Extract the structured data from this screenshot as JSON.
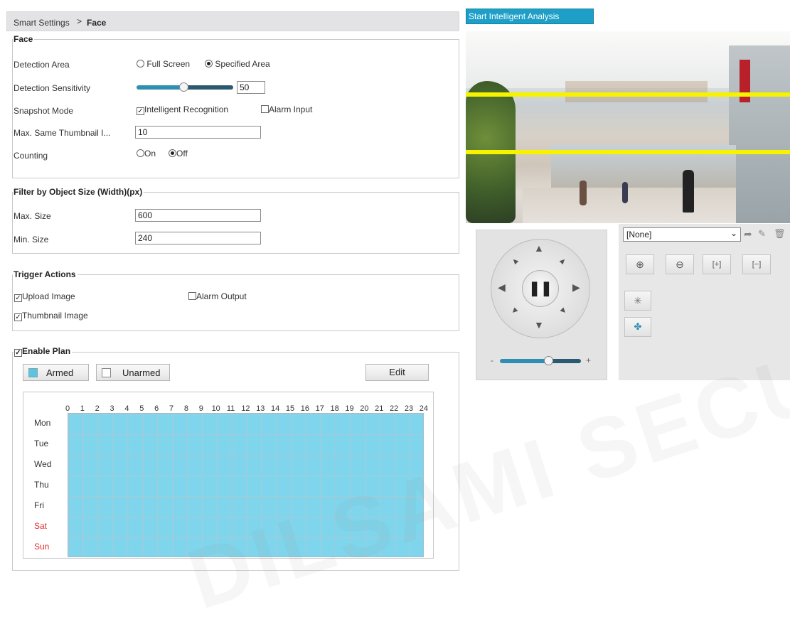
{
  "breadcrumb": {
    "parent": "Smart Settings",
    "separator": ">",
    "current": "Face"
  },
  "face": {
    "legend": "Face",
    "detection_area": {
      "label": "Detection Area",
      "options": [
        "Full Screen",
        "Specified Area"
      ],
      "selected": "Specified Area"
    },
    "detection_sensitivity": {
      "label": "Detection Sensitivity",
      "value": "50",
      "slider_level_percent": 50
    },
    "snapshot_mode": {
      "label": "Snapshot Mode",
      "opt1": "Intelligent Recognition",
      "opt1_checked": true,
      "opt2": "Alarm Input",
      "opt2_checked": false
    },
    "max_thumbnail": {
      "label": "Max. Same Thumbnail I...",
      "value": "10"
    },
    "counting": {
      "label": "Counting",
      "on": "On",
      "off": "Off",
      "selected": "Off"
    }
  },
  "filter": {
    "legend": "Filter by Object Size (Width)(px)",
    "max_label": "Max. Size",
    "max_value": "600",
    "min_label": "Min. Size",
    "min_value": "240"
  },
  "trigger": {
    "legend": "Trigger Actions",
    "upload_image": "Upload Image",
    "alarm_output": "Alarm Output",
    "thumbnail_image": "Thumbnail Image"
  },
  "plan": {
    "legend": "Enable Plan",
    "armed": "Armed",
    "unarmed": "Unarmed",
    "edit": "Edit",
    "hours": [
      "0",
      "1",
      "2",
      "3",
      "4",
      "5",
      "6",
      "7",
      "8",
      "9",
      "10",
      "11",
      "12",
      "13",
      "14",
      "15",
      "16",
      "17",
      "18",
      "19",
      "20",
      "21",
      "22",
      "23",
      "24"
    ],
    "days": [
      "Mon",
      "Tue",
      "Wed",
      "Thu",
      "Fri",
      "Sat",
      "Sun"
    ],
    "weekend_color": "#e03030",
    "armed_color": "#7fd6ec"
  },
  "analysis_button": "Start Intelligent Analysis",
  "ptz": {
    "preset_value": "[None]",
    "zoom_slider_minus": "-",
    "zoom_slider_plus": "+"
  },
  "watermark": "DILSAMI SECURITY"
}
